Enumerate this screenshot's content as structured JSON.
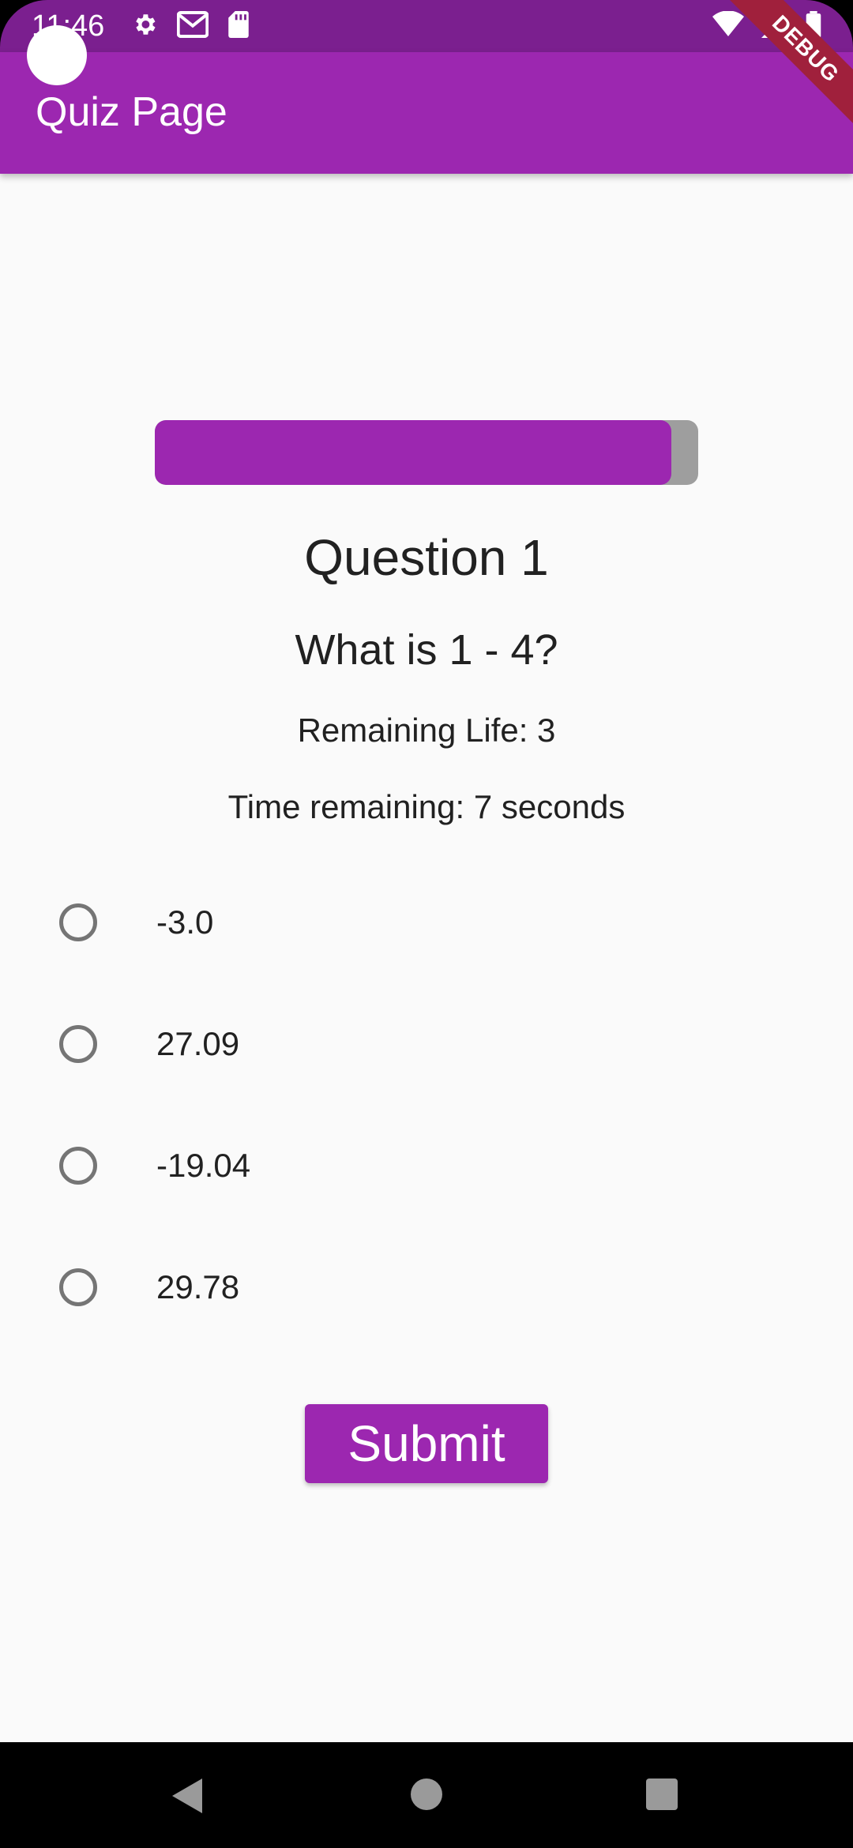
{
  "status_bar": {
    "time": "11:46",
    "left_icons": [
      "gear-icon",
      "gmail-icon",
      "sd-card-icon"
    ],
    "right_icons": [
      "wifi-icon",
      "signal-icon",
      "battery-icon"
    ],
    "color": "#7b1f8f"
  },
  "app_bar": {
    "title": "Quiz Page",
    "color": "#9c27b0"
  },
  "debug_banner": "DEBUG",
  "progress": {
    "fraction": 0.95
  },
  "quiz": {
    "question_number": "Question 1",
    "question": "What is 1 - 4?",
    "remaining_life": "Remaining Life: 3",
    "time_remaining": "Time remaining: 7 seconds"
  },
  "options": [
    {
      "label": "-3.0"
    },
    {
      "label": "27.09"
    },
    {
      "label": "-19.04"
    },
    {
      "label": "29.78"
    }
  ],
  "submit": {
    "label": "Submit"
  },
  "nav_bar": {
    "icons": [
      "back-icon",
      "home-icon",
      "recents-icon"
    ]
  }
}
